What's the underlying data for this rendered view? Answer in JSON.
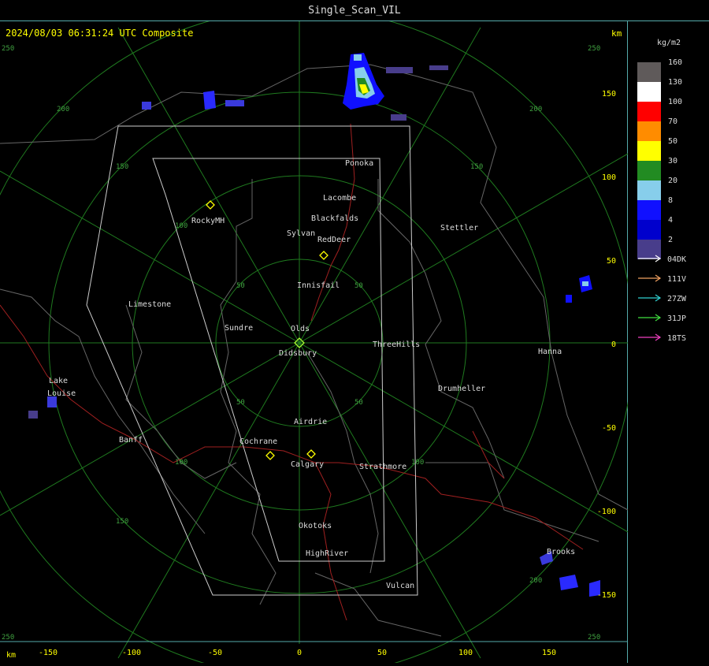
{
  "header": {
    "title": "Single_Scan_VIL"
  },
  "map": {
    "timestamp": "2024/08/03 06:31:24 UTC Composite",
    "km_label_top": "km",
    "km_label_bottom": "km",
    "x_ticks": [
      "-150",
      "-100",
      "-50",
      "0",
      "50",
      "100",
      "150"
    ],
    "y_ticks": [
      "150",
      "100",
      "50",
      "0",
      "-50",
      "-100",
      "-150"
    ],
    "range_ring_labels": [
      "50",
      "100",
      "150",
      "200",
      "250"
    ],
    "towns": [
      "Ponoka",
      "Lacombe",
      "Blackfalds",
      "RockyMH",
      "Sylvan",
      "RedDeer",
      "Stettler",
      "Innisfail",
      "Limestone",
      "Sundre",
      "Olds",
      "Didsbury",
      "ThreeHills",
      "Hanna",
      "Drumheller",
      "Lake",
      "Louise",
      "Airdrie",
      "Banff",
      "Cochrane",
      "Calgary",
      "Strathmore",
      "Okotoks",
      "HighRiver",
      "Brooks",
      "Vulcan"
    ]
  },
  "legend": {
    "unit": "kg/m2",
    "scale": [
      {
        "label": "160",
        "color": "#5f5a5a"
      },
      {
        "label": "130",
        "color": "#ffffff"
      },
      {
        "label": "100",
        "color": "#ff0000"
      },
      {
        "label": "70",
        "color": "#ff8c00"
      },
      {
        "label": "50",
        "color": "#ffff00"
      },
      {
        "label": "30",
        "color": "#228b22"
      },
      {
        "label": "20",
        "color": "#87ceeb"
      },
      {
        "label": "8",
        "color": "#1010ff"
      },
      {
        "label": "4",
        "color": "#0000cd"
      },
      {
        "label": "2",
        "color": "#483d8b"
      }
    ],
    "tracks": [
      {
        "label": "04DK",
        "color": "#ffffff"
      },
      {
        "label": "111V",
        "color": "#f0a060"
      },
      {
        "label": "27ZW",
        "color": "#30d0d0"
      },
      {
        "label": "31JP",
        "color": "#40e040"
      },
      {
        "label": "18TS",
        "color": "#f040c0"
      }
    ]
  }
}
